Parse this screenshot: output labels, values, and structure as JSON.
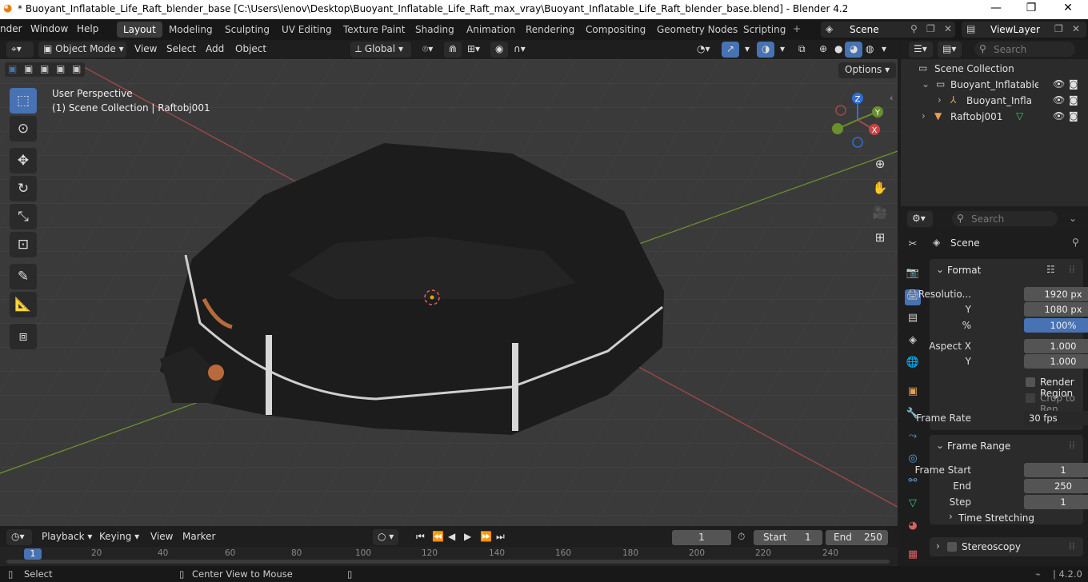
{
  "titlebar": {
    "title": "* Buoyant_Inflatable_Life_Raft_blender_base [C:\\Users\\lenov\\Desktop\\Buoyant_Inflatable_Life_Raft_max_vray\\Buoyant_Inflatable_Life_Raft_blender_base.blend] - Blender 4.2",
    "minimize": "—",
    "maximize": "❐",
    "close": "✕"
  },
  "menus": [
    "nder",
    "Window",
    "Help"
  ],
  "workspaces": [
    "Layout",
    "Modeling",
    "Sculpting",
    "UV Editing",
    "Texture Paint",
    "Shading",
    "Animation",
    "Rendering",
    "Compositing",
    "Geometry Nodes",
    "Scripting"
  ],
  "scene_name": "Scene",
  "view_layer": "ViewLayer",
  "viewport_header": {
    "mode": "Object Mode",
    "menus": [
      "View",
      "Select",
      "Add",
      "Object"
    ],
    "transform": "Global",
    "options": "Options"
  },
  "viewport": {
    "perspective": "User Perspective",
    "collection_info": "(1) Scene Collection | Raftobj001",
    "gizmo_axes": {
      "z": "Z",
      "y": "Y",
      "x": "X"
    },
    "colors": {
      "x_axis": "#a34848",
      "y_axis": "#6a8f2d",
      "z_axis": "#2f6fd6",
      "select": "#4772b3"
    }
  },
  "outliner": {
    "search_placeholder": "Search",
    "rows": [
      {
        "label": "Scene Collection"
      },
      {
        "label": "Buoyant_Inflatable"
      },
      {
        "label": "Buoyant_Inflata"
      },
      {
        "label": "Raftobj001"
      }
    ]
  },
  "properties": {
    "search_placeholder": "Search",
    "context": "Scene",
    "format": {
      "title": "Format",
      "resolution_label": "Resolutio...",
      "res_x": "1920 px",
      "y_label": "Y",
      "res_y": "1080 px",
      "pct_label": "%",
      "pct": "100%",
      "aspect_label": "Aspect X",
      "aspect_x": "1.000",
      "aspect_y": "1.000",
      "render_region": "Render Region",
      "crop": "Crop to Ren...",
      "frame_rate_label": "Frame Rate",
      "frame_rate": "30 fps"
    },
    "frame_range": {
      "title": "Frame Range",
      "start_label": "Frame Start",
      "start": "1",
      "end_label": "End",
      "end": "250",
      "step_label": "Step",
      "step": "1"
    },
    "time_stretching": "Time Stretching",
    "stereoscopy": "Stereoscopy"
  },
  "timeline": {
    "menus": [
      "Playback",
      "Keying",
      "View",
      "Marker"
    ],
    "current_frame": "1",
    "start_label": "Start",
    "start": "1",
    "end_label": "End",
    "end": "250",
    "ticks": [
      "1",
      "20",
      "40",
      "60",
      "80",
      "100",
      "120",
      "140",
      "160",
      "180",
      "200",
      "220",
      "240"
    ]
  },
  "statusbar": {
    "select": "Select",
    "center_view": "Center View to Mouse",
    "version": "4.2.0"
  }
}
